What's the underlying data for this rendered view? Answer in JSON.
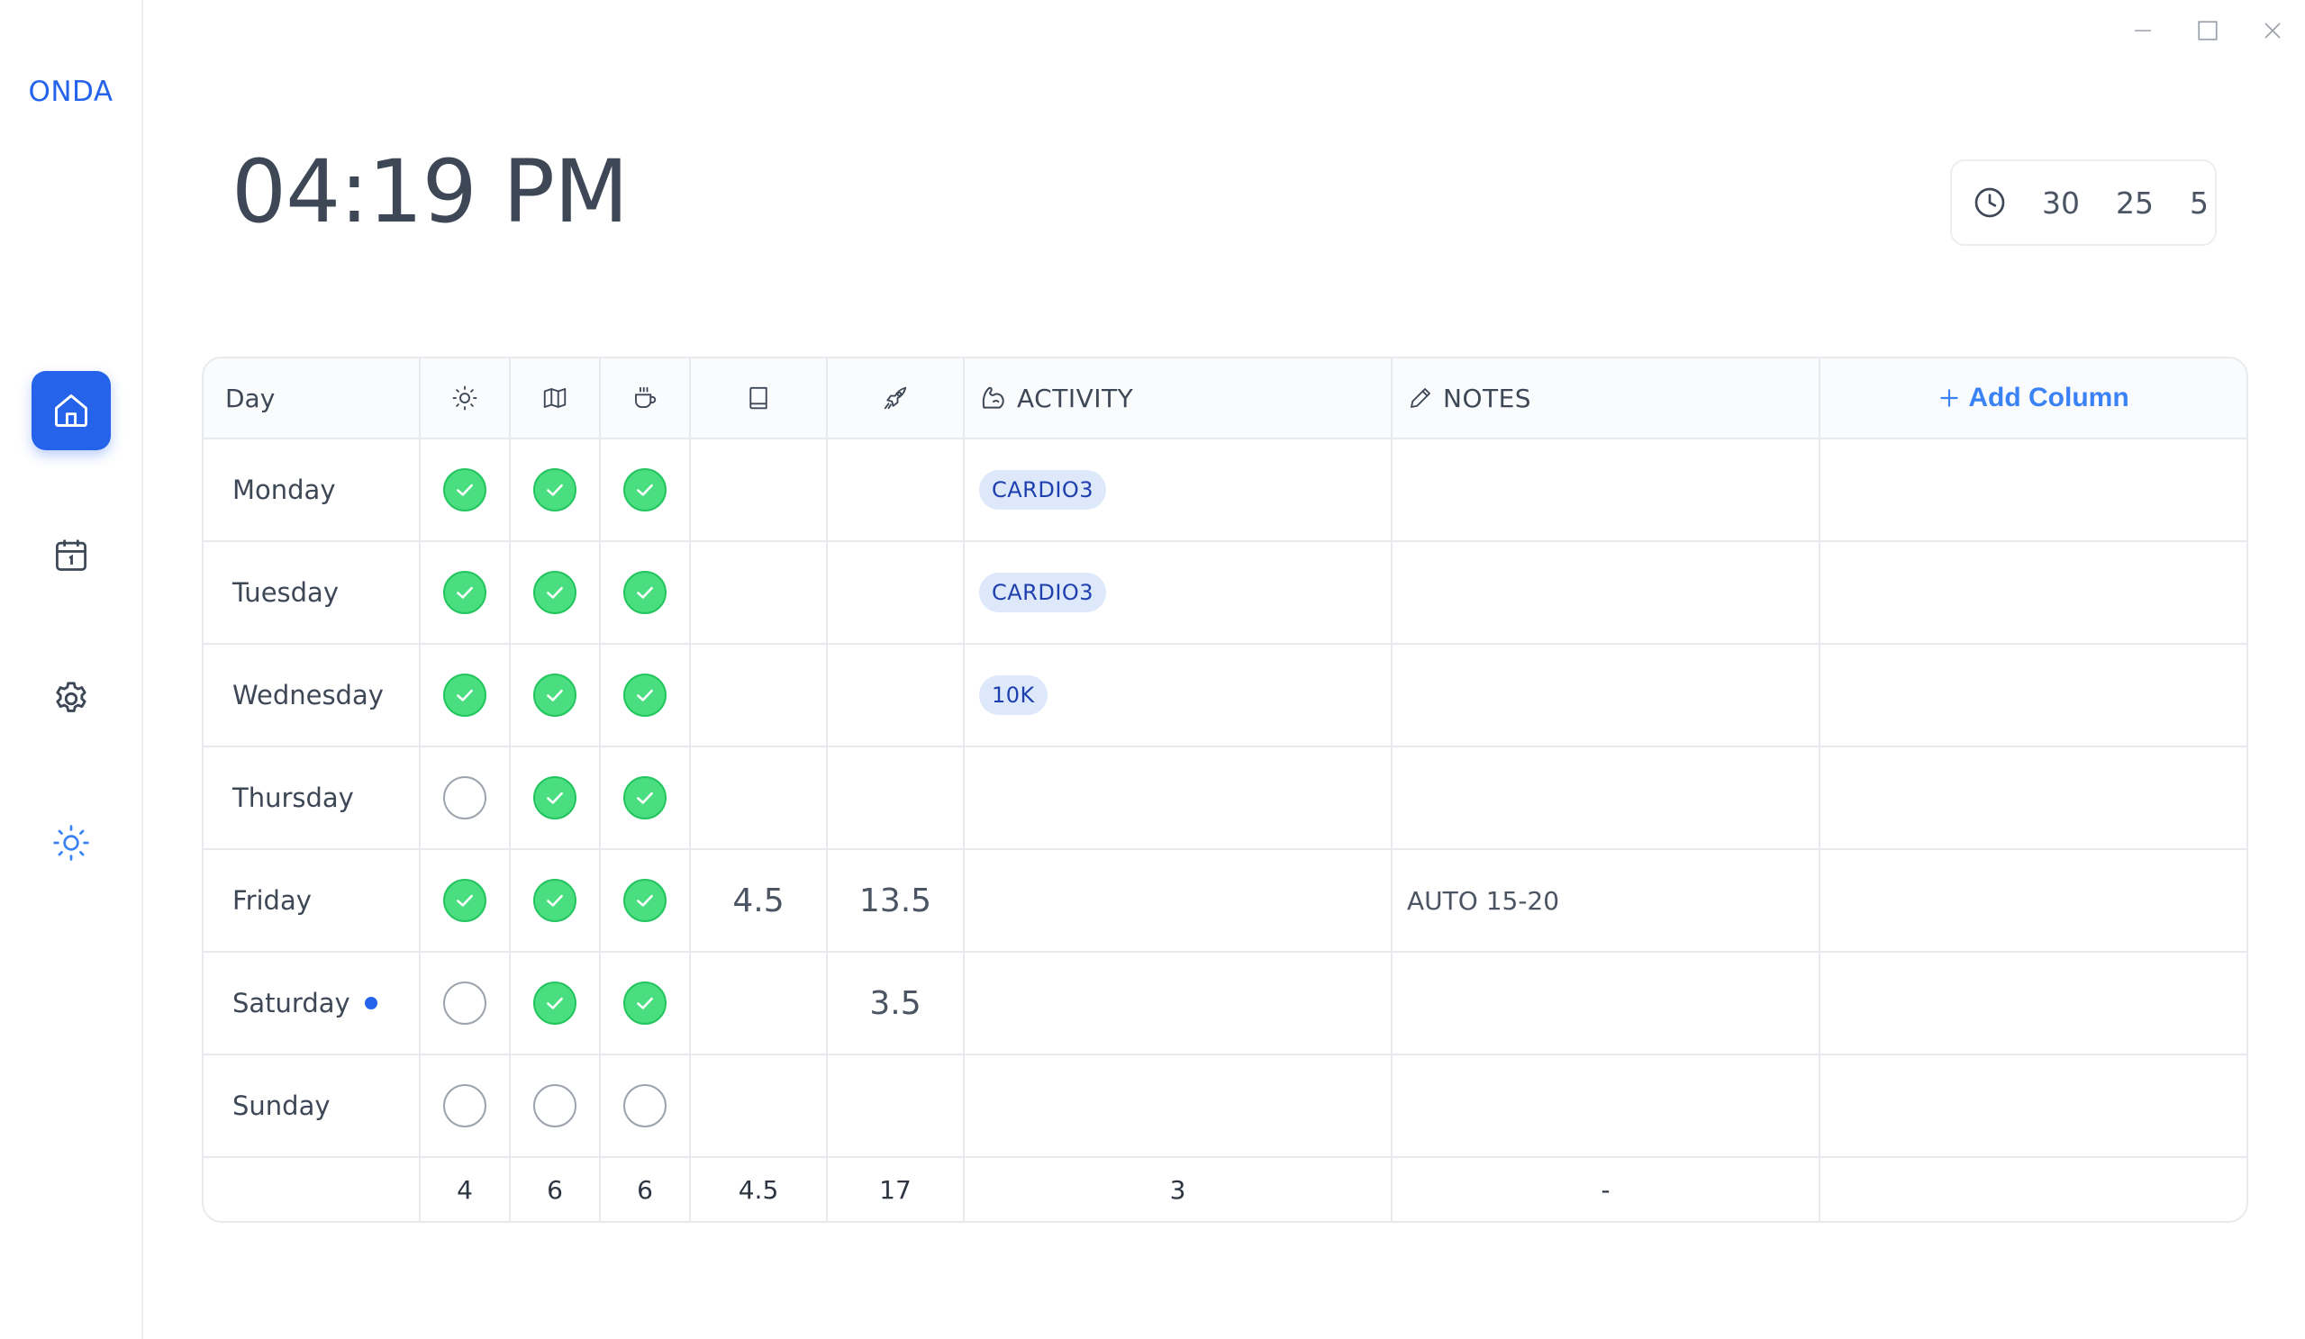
{
  "app": {
    "brand": "ONDA"
  },
  "window_controls": [
    "minimize-icon",
    "maximize-icon",
    "close-icon"
  ],
  "sidebar": {
    "items": [
      {
        "name": "home",
        "icon": "home-icon",
        "active": true
      },
      {
        "name": "calendar",
        "icon": "calendar-icon",
        "active": false
      },
      {
        "name": "settings",
        "icon": "gear-icon",
        "active": false
      },
      {
        "name": "theme",
        "icon": "sun-icon",
        "active": false
      }
    ]
  },
  "clock": {
    "time": "04:19 PM"
  },
  "timer": {
    "icon": "clock-icon",
    "values": [
      "30",
      "25",
      "5"
    ]
  },
  "table": {
    "header": {
      "day": "Day",
      "icon_columns": [
        "sun-icon",
        "map-icon",
        "coffee-icon",
        "book-icon",
        "rocket-icon"
      ],
      "activity": "ACTIVITY",
      "notes": "NOTES",
      "add_column": "Add Column"
    },
    "rows": [
      {
        "day": "Monday",
        "checks": [
          true,
          true,
          true
        ],
        "book": "",
        "rocket": "",
        "activity": "CARDIO3",
        "notes": "",
        "today": false
      },
      {
        "day": "Tuesday",
        "checks": [
          true,
          true,
          true
        ],
        "book": "",
        "rocket": "",
        "activity": "CARDIO3",
        "notes": "",
        "today": false
      },
      {
        "day": "Wednesday",
        "checks": [
          true,
          true,
          true
        ],
        "book": "",
        "rocket": "",
        "activity": "10K",
        "notes": "",
        "today": false
      },
      {
        "day": "Thursday",
        "checks": [
          false,
          true,
          true
        ],
        "book": "",
        "rocket": "",
        "activity": "",
        "notes": "",
        "today": false
      },
      {
        "day": "Friday",
        "checks": [
          true,
          true,
          true
        ],
        "book": "4.5",
        "rocket": "13.5",
        "activity": "",
        "notes": "AUTO 15-20",
        "today": false
      },
      {
        "day": "Saturday",
        "checks": [
          false,
          true,
          true
        ],
        "book": "",
        "rocket": "3.5",
        "activity": "",
        "notes": "",
        "today": true
      },
      {
        "day": "Sunday",
        "checks": [
          false,
          false,
          false
        ],
        "book": "",
        "rocket": "",
        "activity": "",
        "notes": "",
        "today": false
      }
    ],
    "footer": {
      "day": "",
      "sun": "4",
      "map": "6",
      "coffee": "6",
      "book": "4.5",
      "rocket": "17",
      "activity": "3",
      "notes": "-"
    }
  },
  "colors": {
    "accent": "#2563eb",
    "check": "#4ade80",
    "tag_bg": "#dde8fb",
    "tag_text": "#1e40af"
  }
}
